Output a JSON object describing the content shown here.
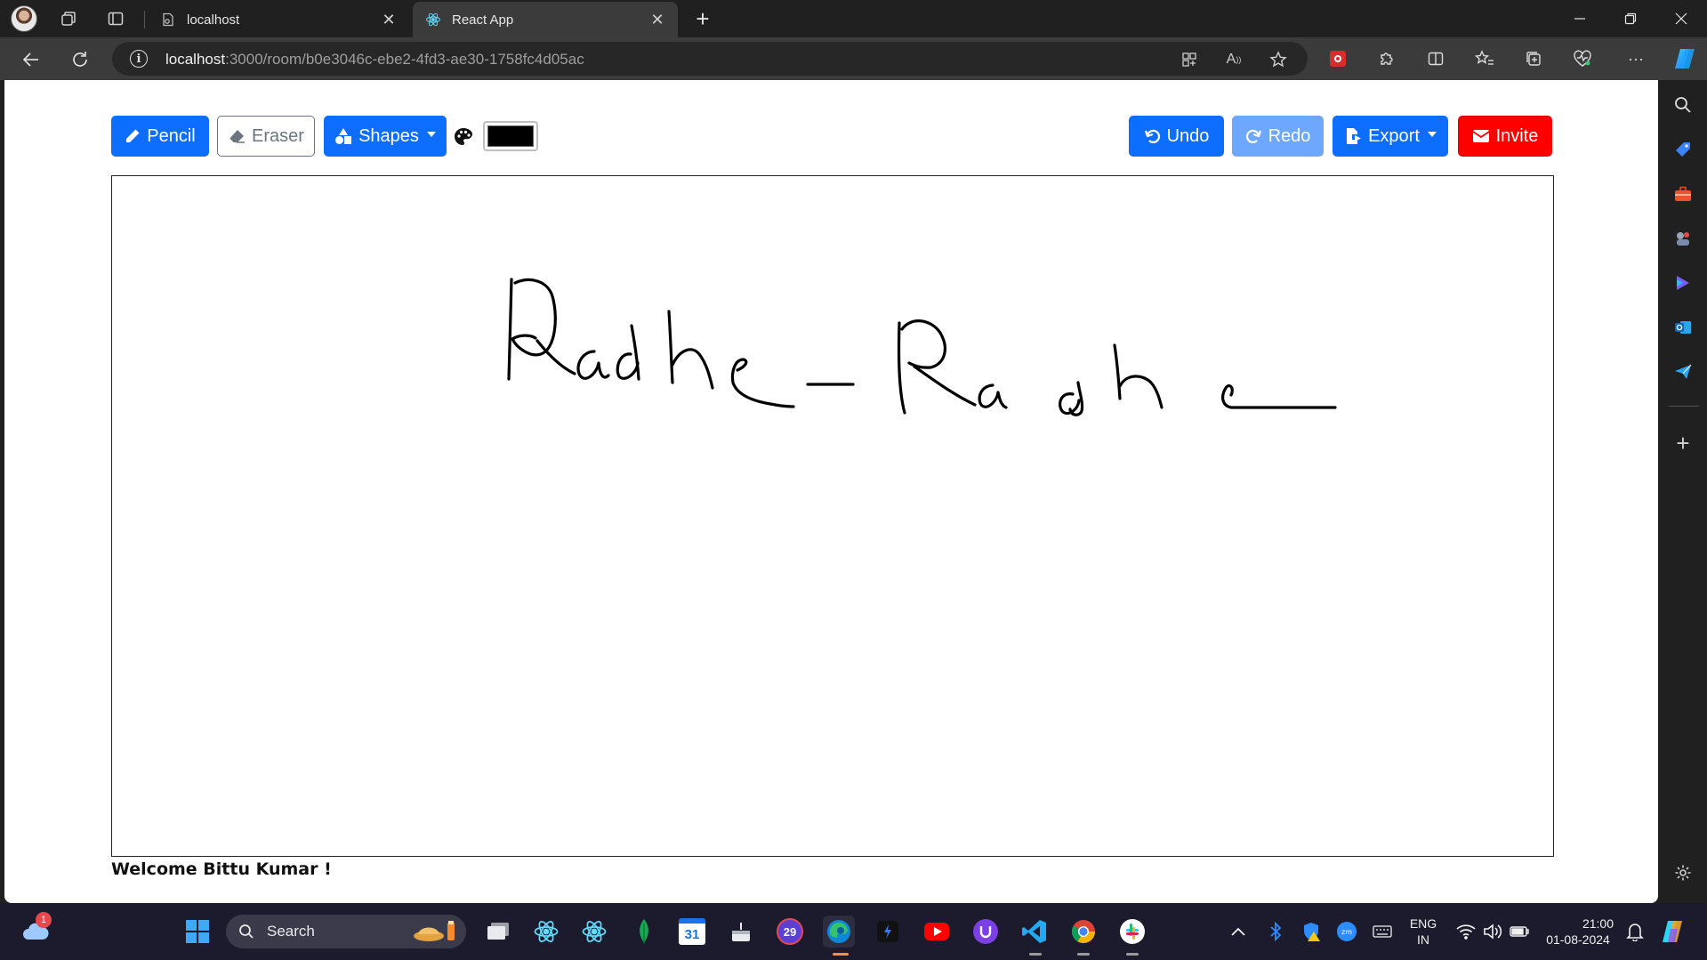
{
  "browser": {
    "tabs": [
      {
        "title": "localhost",
        "active": false
      },
      {
        "title": "React App",
        "active": true
      }
    ],
    "address": {
      "host": "localhost",
      "path": ":3000/room/b0e3046c-ebe2-4fd3-ae30-1758fc4d05ac"
    }
  },
  "toolbar": {
    "pencil": "Pencil",
    "eraser": "Eraser",
    "shapes": "Shapes",
    "undo": "Undo",
    "redo": "Redo",
    "export": "Export",
    "invite": "Invite",
    "selected_color": "#000000"
  },
  "canvas": {
    "drawing_color": "#000000",
    "handwriting": "Radhe-Radhe"
  },
  "footer": {
    "welcome": "Welcome Bittu Kumar !"
  },
  "taskbar": {
    "search_label": "Search",
    "weather_badge": "1",
    "language": "ENG",
    "region": "IN",
    "time": "21:00",
    "date": "01-08-2024",
    "calendar_day": "31",
    "notification_count": "29"
  },
  "colors": {
    "primary": "#0d6efd",
    "danger": "#ff0000",
    "redo_disabled": "#6ea8fe"
  }
}
